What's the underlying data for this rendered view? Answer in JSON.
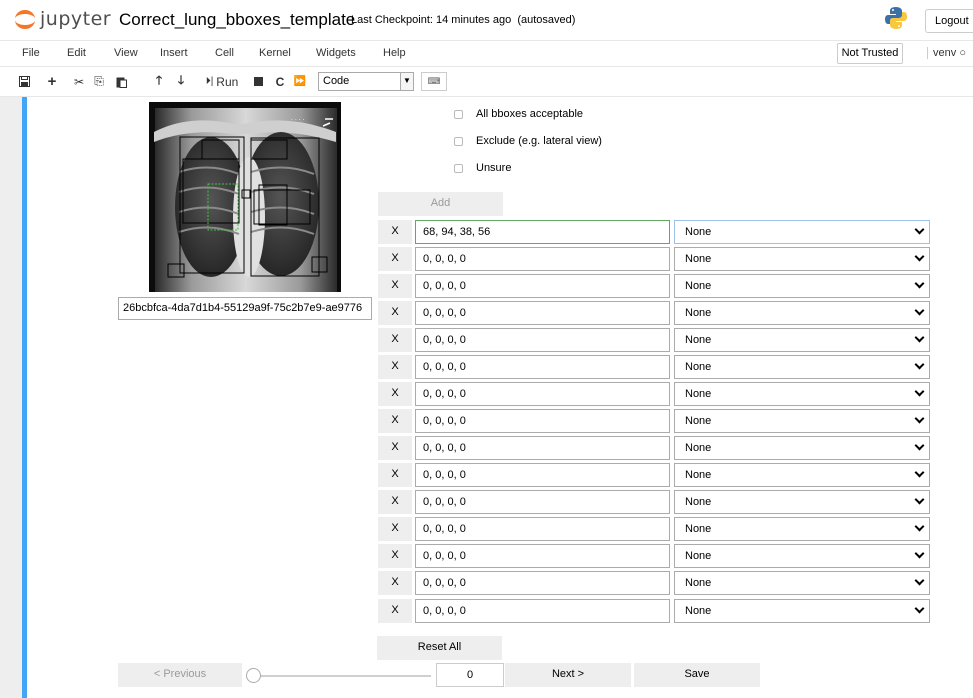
{
  "header": {
    "logo_text": "jupyter",
    "notebook_title": "Correct_lung_bboxes_template",
    "checkpoint": "Last Checkpoint: 14 minutes ago",
    "autosave": "(autosaved)",
    "logout": "Logout"
  },
  "menubar": {
    "items": [
      "File",
      "Edit",
      "View",
      "Insert",
      "Cell",
      "Kernel",
      "Widgets",
      "Help"
    ],
    "trust_status": "Not Trusted",
    "kernel": "venv"
  },
  "toolbar": {
    "run_label": "Run",
    "cell_type": "Code",
    "icons": [
      "save-icon",
      "plus-icon",
      "scissors-icon",
      "copy-icon",
      "paste-icon",
      "arrow-up-icon",
      "arrow-down-icon",
      "run-icon",
      "stop-icon",
      "restart-icon",
      "fast-forward-icon",
      "keyboard-icon"
    ]
  },
  "widget": {
    "image_id": "26bcbfca-4da7d1b4-55129a9f-75c2b7e9-ae9776",
    "checkboxes": [
      {
        "label": "All bboxes acceptable",
        "checked": false
      },
      {
        "label": "Exclude (e.g. lateral view)",
        "checked": false
      },
      {
        "label": "Unsure",
        "checked": false
      }
    ],
    "add_label": "Add",
    "remove_label": "X",
    "rows": [
      {
        "coords": "68, 94, 38, 56",
        "label": "None"
      },
      {
        "coords": "0, 0, 0, 0",
        "label": "None"
      },
      {
        "coords": "0, 0, 0, 0",
        "label": "None"
      },
      {
        "coords": "0, 0, 0, 0",
        "label": "None"
      },
      {
        "coords": "0, 0, 0, 0",
        "label": "None"
      },
      {
        "coords": "0, 0, 0, 0",
        "label": "None"
      },
      {
        "coords": "0, 0, 0, 0",
        "label": "None"
      },
      {
        "coords": "0, 0, 0, 0",
        "label": "None"
      },
      {
        "coords": "0, 0, 0, 0",
        "label": "None"
      },
      {
        "coords": "0, 0, 0, 0",
        "label": "None"
      },
      {
        "coords": "0, 0, 0, 0",
        "label": "None"
      },
      {
        "coords": "0, 0, 0, 0",
        "label": "None"
      },
      {
        "coords": "0, 0, 0, 0",
        "label": "None"
      },
      {
        "coords": "0, 0, 0, 0",
        "label": "None"
      },
      {
        "coords": "0, 0, 0, 0",
        "label": "None"
      }
    ],
    "reset_label": "Reset All",
    "prev_label": "< Previous",
    "index_value": "0",
    "index_fraction": 0,
    "next_label": "Next >",
    "save_label": "Save"
  },
  "colors": {
    "accent": "#42a5f5",
    "jupyter_orange": "#f37726",
    "focus_green": "#64a764",
    "button_grey": "#eeeeee"
  }
}
